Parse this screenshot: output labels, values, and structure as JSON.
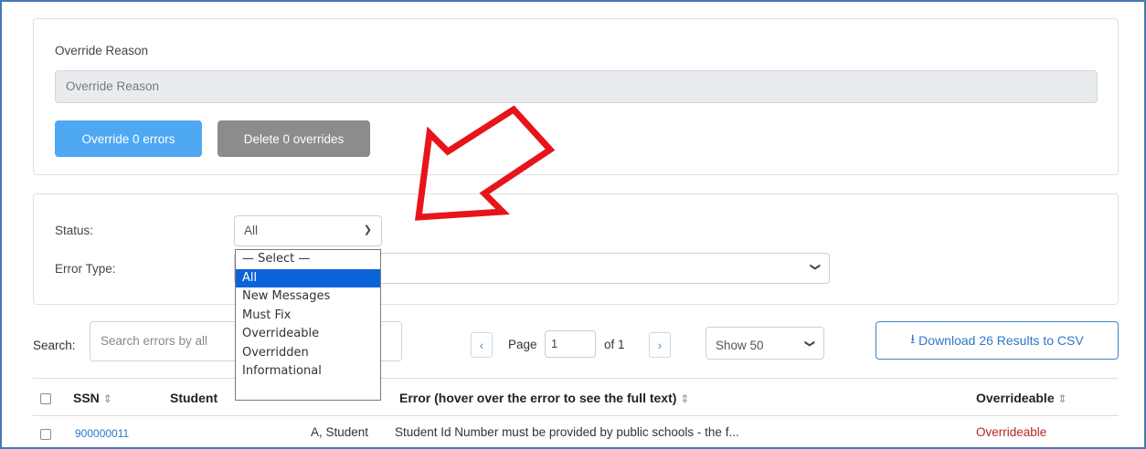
{
  "override": {
    "reason_label": "Override Reason",
    "reason_placeholder": "Override Reason",
    "override_button": "Override 0 errors",
    "delete_button": "Delete 0 overrides"
  },
  "filters": {
    "status_label": "Status:",
    "status_value": "All",
    "error_type_label": "Error Type:",
    "status_options": [
      "— Select —",
      "All",
      "New Messages",
      "Must Fix",
      "Overrideable",
      "Overridden",
      "Informational"
    ],
    "selected_option_index": 1
  },
  "toolbar": {
    "search_label": "Search:",
    "search_placeholder": "Search errors by all",
    "page_label": "Page",
    "page_value": "1",
    "of_label": "of 1",
    "show_value": "Show 50",
    "download_label": "Download 26 Results to CSV"
  },
  "table": {
    "columns": {
      "ssn": "SSN",
      "student": "Student",
      "error": "Error (hover over the error to see the full text)",
      "overrideable": "Overrideable"
    },
    "rows": [
      {
        "ssn": "900000011",
        "student": "A, Student",
        "error": "Student Id Number must be provided by public schools - the f...",
        "overrideable": "Overrideable"
      }
    ]
  },
  "icons": {
    "chevron": "chevron-down-icon",
    "prev": "chevron-left-icon",
    "next": "chevron-right-icon",
    "download": "download-icon",
    "sort": "sort-icon"
  },
  "colors": {
    "primary": "#4ea8f2",
    "secondary": "#8c8c8c",
    "link": "#2c78c8",
    "overrideable": "#b02a2a",
    "highlight": "#0a64d8",
    "annotation_arrow": "#e8141b"
  }
}
